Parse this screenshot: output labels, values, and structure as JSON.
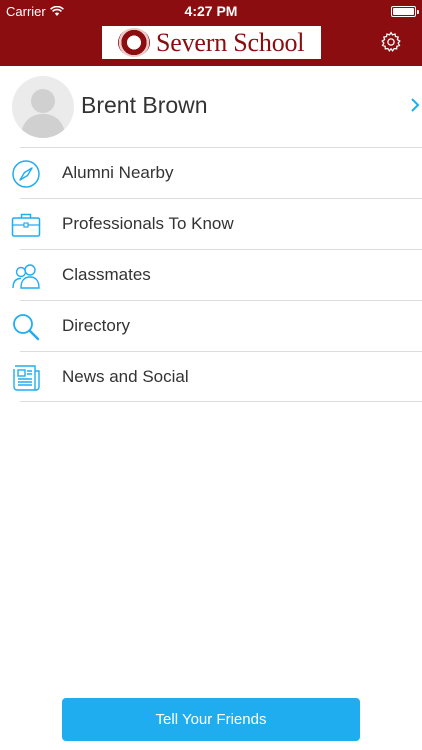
{
  "status_bar": {
    "carrier": "Carrier",
    "time": "4:27 PM"
  },
  "header": {
    "logo_text": "Severn School"
  },
  "profile": {
    "name": "Brent Brown"
  },
  "menu": {
    "items": [
      {
        "label": "Alumni Nearby",
        "icon": "compass-icon"
      },
      {
        "label": "Professionals To Know",
        "icon": "briefcase-icon"
      },
      {
        "label": "Classmates",
        "icon": "people-icon"
      },
      {
        "label": "Directory",
        "icon": "search-icon"
      },
      {
        "label": "News and Social",
        "icon": "newspaper-icon"
      }
    ]
  },
  "cta": {
    "label": "Tell Your Friends"
  },
  "colors": {
    "brand": "#8b0d10",
    "accent": "#1fadf0"
  }
}
